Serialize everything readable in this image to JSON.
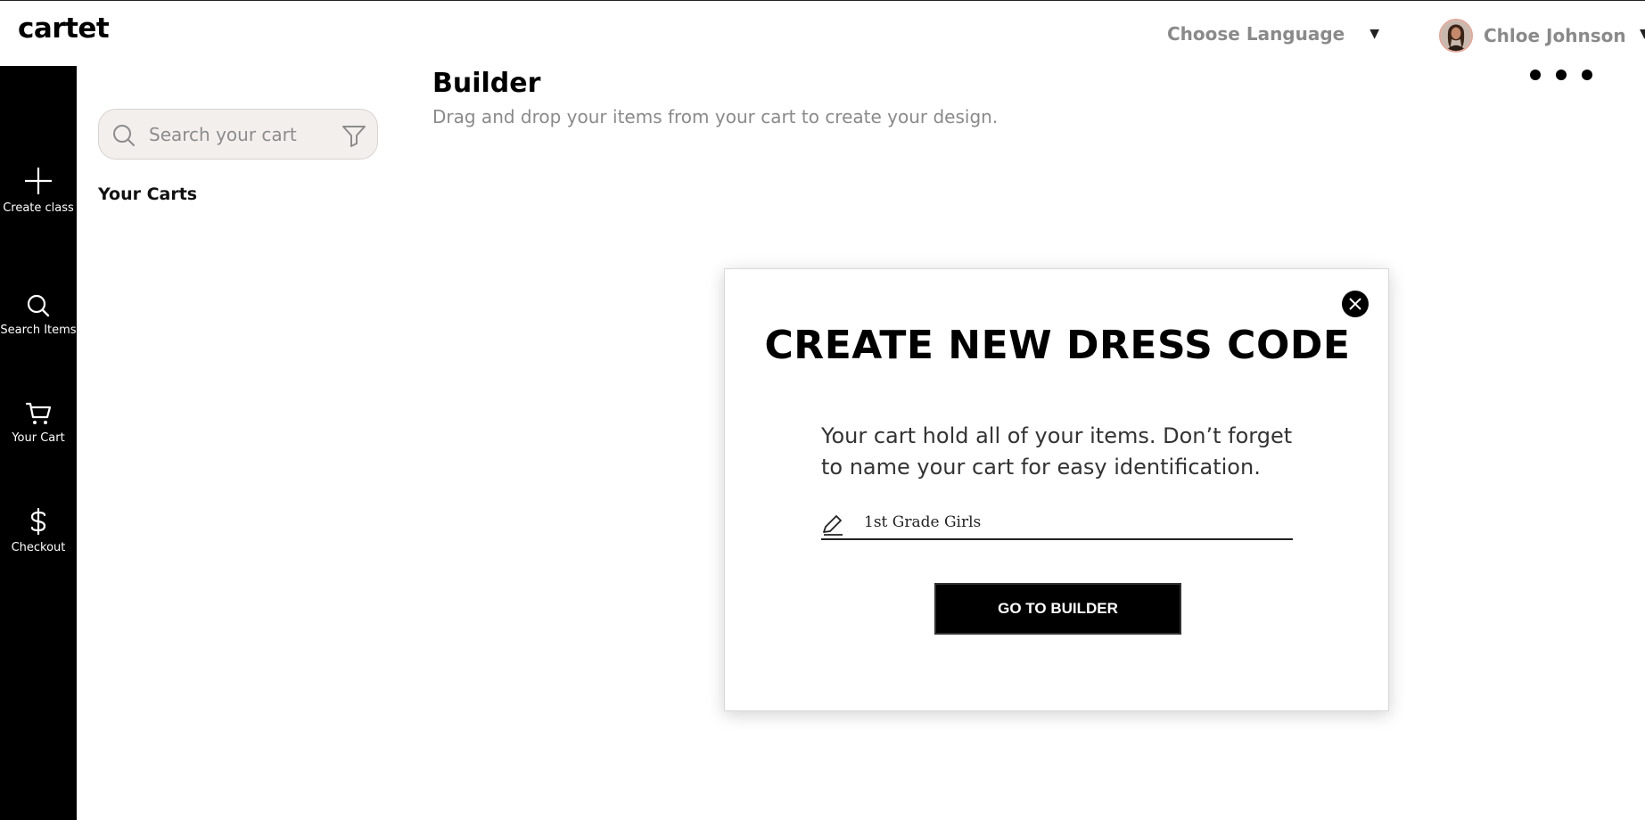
{
  "header": {
    "logo": "cartet",
    "language_label": "Choose Language",
    "user_name": "Chloe Johnson"
  },
  "sidebar": {
    "items": [
      {
        "label": "Create class",
        "icon": "plus-icon"
      },
      {
        "label": "Search Items",
        "icon": "search-icon"
      },
      {
        "label": "Your Cart",
        "icon": "cart-icon"
      },
      {
        "label": "Checkout",
        "icon": "dollar-icon"
      }
    ]
  },
  "left_panel": {
    "search_placeholder": "Search your cart",
    "carts_title": "Your Carts"
  },
  "main": {
    "title": "Builder",
    "subtitle": "Drag and drop your items from your cart to create your design."
  },
  "modal": {
    "title": "CREATE NEW DRESS CODE",
    "description": "Your cart hold all of your items. Don’t forget to name your cart for easy identification.",
    "cart_name_value": "1st Grade Girls",
    "button_label": "GO TO BUILDER"
  }
}
